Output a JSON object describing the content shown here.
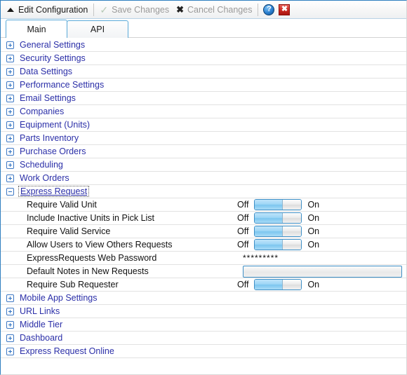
{
  "window": {
    "title": "Edit Configuration",
    "collapse_icon": "caret-up-icon"
  },
  "toolbar": {
    "save_label": "Save Changes",
    "save_icon": "check-icon",
    "cancel_label": "Cancel Changes",
    "cancel_icon": "x-icon",
    "help_icon": "?",
    "close_icon": "✖",
    "accent_blue": "#2f7fbf",
    "disabled_text": "#9a9a9a"
  },
  "tabs": [
    {
      "label": "Main",
      "active": true
    },
    {
      "label": "API",
      "active": false
    }
  ],
  "tree": {
    "collapsed_icon": "plus-box-icon",
    "expanded_icon": "minus-box-icon",
    "group_text_color": "#2b2fa8",
    "rows": [
      {
        "kind": "group",
        "label": "General Settings",
        "expanded": false,
        "focused": false
      },
      {
        "kind": "group",
        "label": "Security Settings",
        "expanded": false,
        "focused": false
      },
      {
        "kind": "group",
        "label": "Data Settings",
        "expanded": false,
        "focused": false
      },
      {
        "kind": "group",
        "label": "Performance Settings",
        "expanded": false,
        "focused": false
      },
      {
        "kind": "group",
        "label": "Email Settings",
        "expanded": false,
        "focused": false
      },
      {
        "kind": "group",
        "label": "Companies",
        "expanded": false,
        "focused": false
      },
      {
        "kind": "group",
        "label": "Equipment (Units)",
        "expanded": false,
        "focused": false
      },
      {
        "kind": "group",
        "label": "Parts Inventory",
        "expanded": false,
        "focused": false
      },
      {
        "kind": "group",
        "label": "Purchase Orders",
        "expanded": false,
        "focused": false
      },
      {
        "kind": "group",
        "label": "Scheduling",
        "expanded": false,
        "focused": false
      },
      {
        "kind": "group",
        "label": "Work Orders",
        "expanded": false,
        "focused": false
      },
      {
        "kind": "group",
        "label": "Express Request",
        "expanded": true,
        "focused": true
      },
      {
        "kind": "child",
        "label": "Require Valid Unit",
        "control": "toggle",
        "off_label": "Off",
        "on_label": "On",
        "value": "Off"
      },
      {
        "kind": "child",
        "label": "Include Inactive Units in Pick List",
        "control": "toggle",
        "off_label": "Off",
        "on_label": "On",
        "value": "Off"
      },
      {
        "kind": "child",
        "label": "Require Valid Service",
        "control": "toggle",
        "off_label": "Off",
        "on_label": "On",
        "value": "Off"
      },
      {
        "kind": "child",
        "label": "Allow Users to View Others Requests",
        "control": "toggle",
        "off_label": "Off",
        "on_label": "On",
        "value": "Off"
      },
      {
        "kind": "child",
        "label": "ExpressRequests Web Password",
        "control": "password",
        "value": "*********"
      },
      {
        "kind": "child",
        "label": "Default Notes in New Requests",
        "control": "textbox",
        "value": ""
      },
      {
        "kind": "child",
        "label": "Require Sub Requester",
        "control": "toggle",
        "off_label": "Off",
        "on_label": "On",
        "value": "Off"
      },
      {
        "kind": "group",
        "label": "Mobile App Settings",
        "expanded": false,
        "focused": false
      },
      {
        "kind": "group",
        "label": "URL Links",
        "expanded": false,
        "focused": false
      },
      {
        "kind": "group",
        "label": "Middle Tier",
        "expanded": false,
        "focused": false
      },
      {
        "kind": "group",
        "label": "Dashboard",
        "expanded": false,
        "focused": false
      },
      {
        "kind": "group",
        "label": "Express Request Online",
        "expanded": false,
        "focused": false
      }
    ]
  }
}
